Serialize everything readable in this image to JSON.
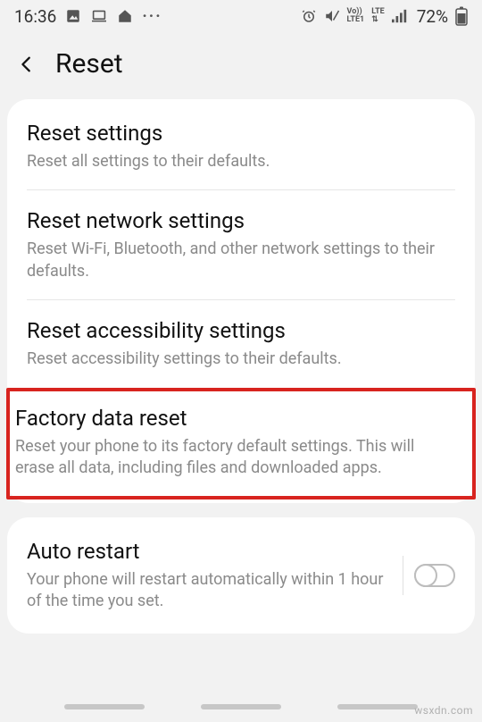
{
  "status": {
    "time": "16:36",
    "battery": "72%"
  },
  "header": {
    "title": "Reset"
  },
  "items": {
    "reset_settings": {
      "title": "Reset settings",
      "desc": "Reset all settings to their defaults."
    },
    "reset_network": {
      "title": "Reset network settings",
      "desc": "Reset Wi-Fi, Bluetooth, and other network settings to their defaults."
    },
    "reset_accessibility": {
      "title": "Reset accessibility settings",
      "desc": "Reset accessibility settings to their defaults."
    },
    "factory_reset": {
      "title": "Factory data reset",
      "desc": "Reset your phone to its factory default settings. This will erase all data, including files and downloaded apps."
    },
    "auto_restart": {
      "title": "Auto restart",
      "desc": "Your phone will restart automatically within 1 hour of the time you set."
    }
  },
  "watermark": "wsxdn.com"
}
